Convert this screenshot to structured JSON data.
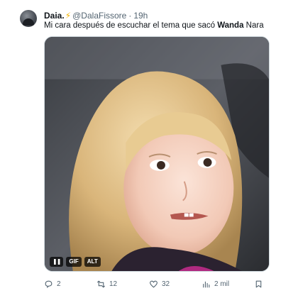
{
  "tweet": {
    "display_name": "Daia.",
    "name_emoji": "⚡",
    "handle": "@DalaFissore",
    "separator": "·",
    "time": "19h",
    "text_before": "Mi cara después de escuchar el tema que sacó ",
    "text_bold": "Wanda",
    "text_after": " Nara"
  },
  "media": {
    "badges": [
      "❚❚",
      "GIF",
      "ALT"
    ]
  },
  "actions": {
    "replies": "2",
    "retweets": "12",
    "likes": "32",
    "views": "2 mil"
  },
  "icons": {
    "reply": "reply-icon",
    "retweet": "retweet-icon",
    "like": "heart-icon",
    "views": "views-icon",
    "bookmark": "bookmark-icon"
  },
  "colors": {
    "text_primary": "#0f1419",
    "text_secondary": "#536471",
    "border": "#cfd9de"
  }
}
